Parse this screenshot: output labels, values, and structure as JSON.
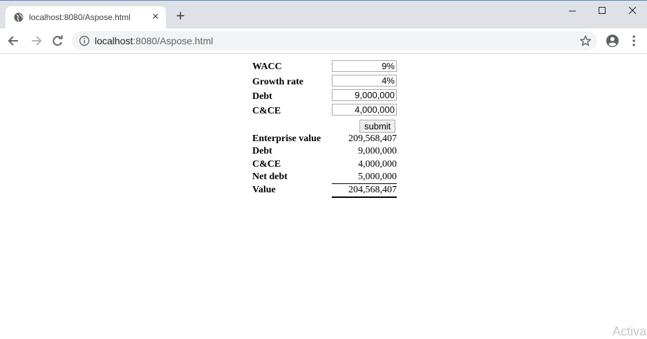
{
  "browser": {
    "tab_title": "localhost:8080/Aspose.html",
    "tab_close": "×",
    "new_tab": "+",
    "url_host": "localhost",
    "url_rest": ":8080/Aspose.html",
    "icons": [
      "globe-icon",
      "close-icon",
      "plus-icon",
      "minimize-icon",
      "maximize-icon",
      "window-close-icon",
      "back-arrow-icon",
      "forward-arrow-icon",
      "reload-icon",
      "info-icon",
      "star-icon",
      "account-icon",
      "more-vert-icon"
    ]
  },
  "form": {
    "wacc": {
      "label": "WACC",
      "value": "9%"
    },
    "growth": {
      "label": "Growth rate",
      "value": "4%"
    },
    "debt": {
      "label": "Debt",
      "value": "9,000,000"
    },
    "cce": {
      "label": "C&CE",
      "value": "4,000,000"
    },
    "submit_label": "submit"
  },
  "results": [
    {
      "label": "Enterprise value",
      "value": "209,568,407"
    },
    {
      "label": "Debt",
      "value": "9,000,000"
    },
    {
      "label": "C&CE",
      "value": "4,000,000"
    },
    {
      "label": "Net debt",
      "value": "5,000,000"
    },
    {
      "label": "Value",
      "value": "204,568,407"
    }
  ],
  "watermark": "Activa",
  "colors": {
    "tabstrip": "#dee1e6",
    "omnibox": "#f1f3f4",
    "accent": "#4a86c8"
  }
}
